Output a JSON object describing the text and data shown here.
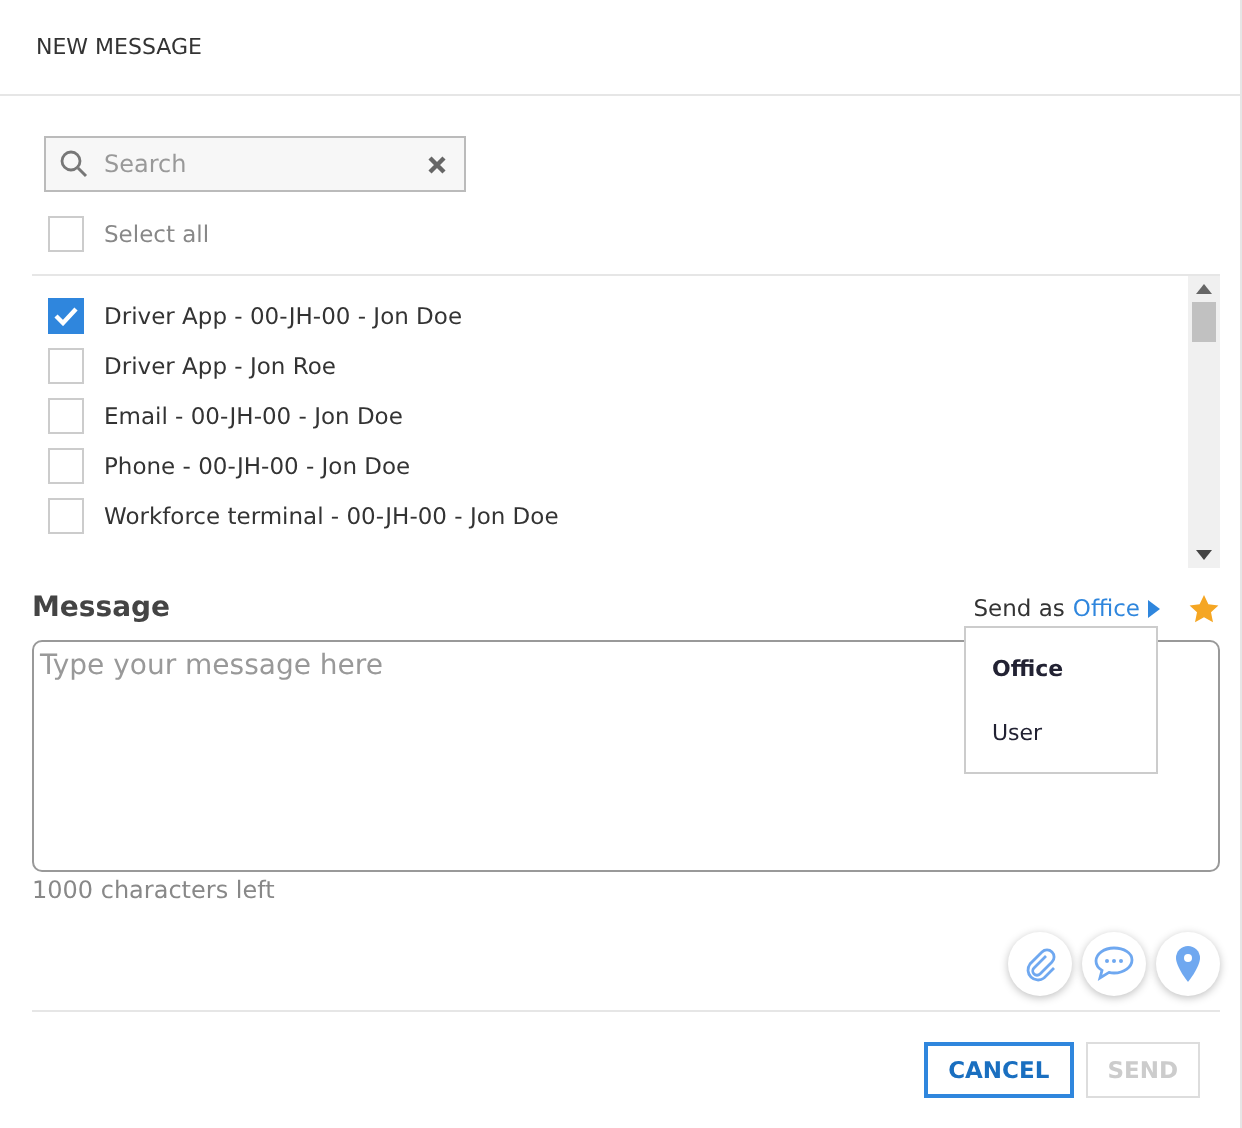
{
  "window": {
    "title": "NEW MESSAGE"
  },
  "search": {
    "placeholder": "Search"
  },
  "select_all": {
    "label": "Select all",
    "checked": false
  },
  "recipients": [
    {
      "label": "Driver App - 00-JH-00 - Jon Doe",
      "checked": true
    },
    {
      "label": "Driver App - Jon Roe",
      "checked": false
    },
    {
      "label": "Email - 00-JH-00 - Jon Doe",
      "checked": false
    },
    {
      "label": "Phone - 00-JH-00 - Jon Doe",
      "checked": false
    },
    {
      "label": "Workforce terminal - 00-JH-00 - Jon Doe",
      "checked": false
    }
  ],
  "message": {
    "label": "Message",
    "placeholder": "Type your message here",
    "chars_left": "1000 characters left"
  },
  "send_as": {
    "label": "Send as",
    "value": "Office",
    "options": [
      {
        "label": "Office",
        "selected": true
      },
      {
        "label": "User",
        "selected": false
      }
    ]
  },
  "buttons": [
    {
      "label": "CANCEL",
      "disabled": false
    },
    {
      "label": "SEND",
      "disabled": true
    }
  ]
}
